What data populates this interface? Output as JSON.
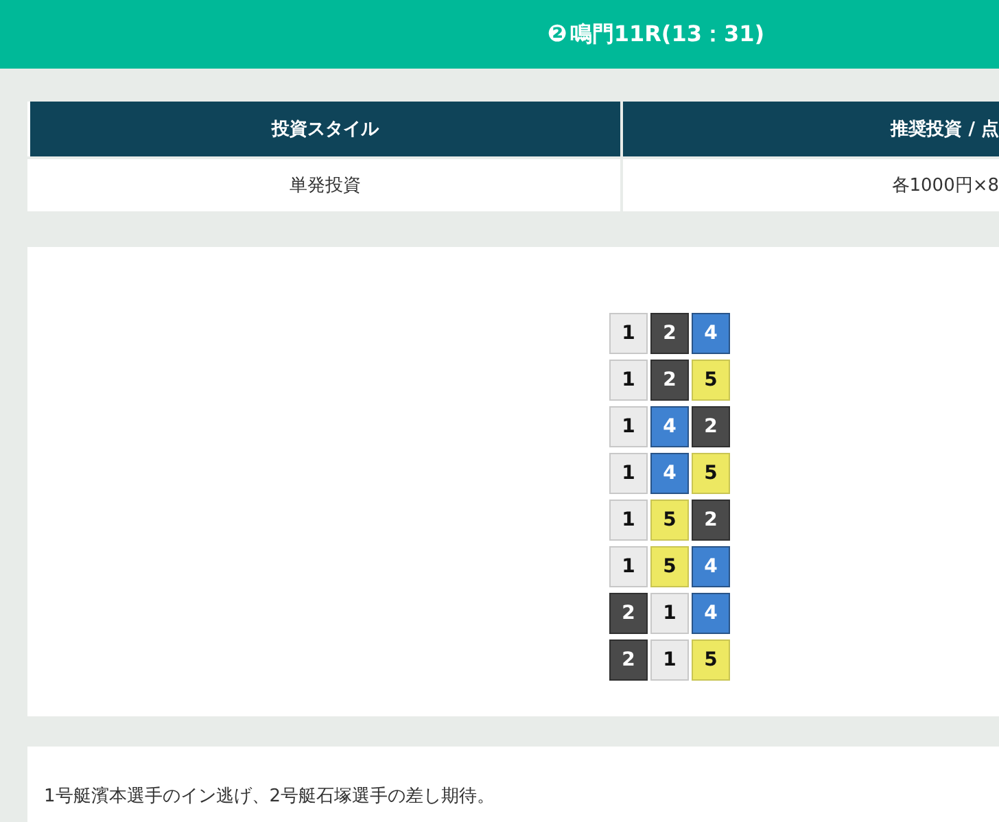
{
  "header": {
    "race_number": "❷",
    "title": "鳴門11R(13：31)"
  },
  "table": {
    "columns": [
      "投資スタイル",
      "推奨投資 / 点"
    ],
    "rows": [
      [
        "単発投資",
        "各1000円×8"
      ]
    ]
  },
  "combinations": [
    [
      {
        "boat": "1",
        "color": "#ebebeb"
      },
      {
        "boat": "2",
        "color": "#4a4a4a"
      },
      {
        "boat": "4",
        "color": "#3f82d1"
      }
    ],
    [
      {
        "boat": "1",
        "color": "#ebebeb"
      },
      {
        "boat": "2",
        "color": "#4a4a4a"
      },
      {
        "boat": "5",
        "color": "#ede862"
      }
    ],
    [
      {
        "boat": "1",
        "color": "#ebebeb"
      },
      {
        "boat": "4",
        "color": "#3f82d1"
      },
      {
        "boat": "2",
        "color": "#4a4a4a"
      }
    ],
    [
      {
        "boat": "1",
        "color": "#ebebeb"
      },
      {
        "boat": "4",
        "color": "#3f82d1"
      },
      {
        "boat": "5",
        "color": "#ede862"
      }
    ],
    [
      {
        "boat": "1",
        "color": "#ebebeb"
      },
      {
        "boat": "5",
        "color": "#ede862"
      },
      {
        "boat": "2",
        "color": "#4a4a4a"
      }
    ],
    [
      {
        "boat": "1",
        "color": "#ebebeb"
      },
      {
        "boat": "5",
        "color": "#ede862"
      },
      {
        "boat": "4",
        "color": "#3f82d1"
      }
    ],
    [
      {
        "boat": "2",
        "color": "#4a4a4a"
      },
      {
        "boat": "1",
        "color": "#ebebeb"
      },
      {
        "boat": "4",
        "color": "#3f82d1"
      }
    ],
    [
      {
        "boat": "2",
        "color": "#4a4a4a"
      },
      {
        "boat": "1",
        "color": "#ebebeb"
      },
      {
        "boat": "5",
        "color": "#ede862"
      }
    ]
  ],
  "comment": "1号艇濱本選手のイン逃げ、2号艇石塚選手の差し期待。"
}
